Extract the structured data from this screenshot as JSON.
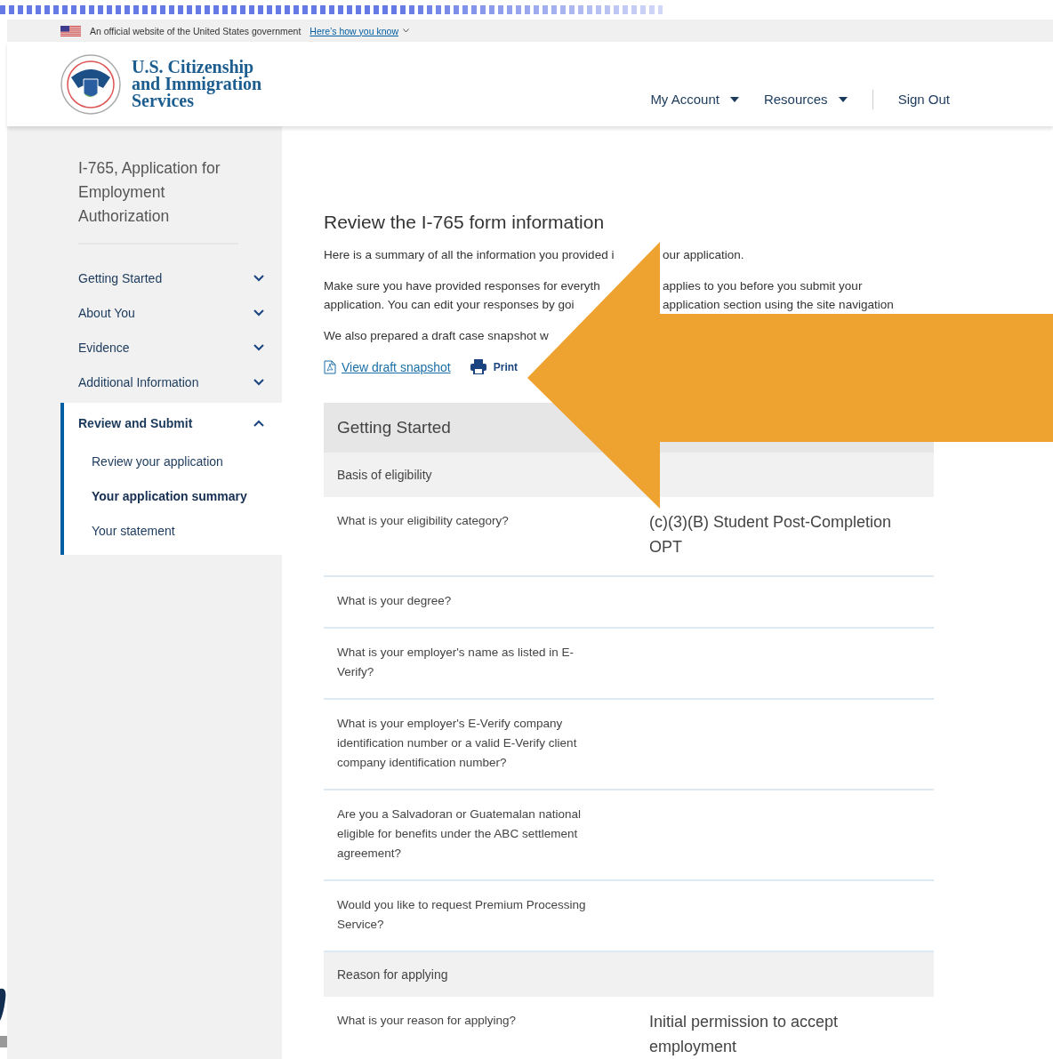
{
  "banner": {
    "text": "An official website of the United States government",
    "link": "Here’s how you know"
  },
  "header": {
    "agency_name": [
      "U.S. Citizenship",
      "and Immigration",
      "Services"
    ],
    "nav": [
      {
        "label": "My Account",
        "kind": "dropdown"
      },
      {
        "label": "Resources",
        "kind": "dropdown"
      },
      {
        "label": "Sign Out",
        "kind": "link"
      }
    ]
  },
  "sidebar": {
    "title": "I-765, Application for Employment Authorization",
    "sections": [
      {
        "label": "Getting Started",
        "expanded": false,
        "selected": false
      },
      {
        "label": "About You",
        "expanded": false,
        "selected": false
      },
      {
        "label": "Evidence",
        "expanded": false,
        "selected": false
      },
      {
        "label": "Additional Information",
        "expanded": false,
        "selected": false
      },
      {
        "label": "Review and Submit",
        "expanded": true,
        "selected": true,
        "children": [
          {
            "label": "Review your application",
            "selected": false
          },
          {
            "label": "Your application summary",
            "selected": true
          },
          {
            "label": "Your statement",
            "selected": false
          }
        ]
      }
    ]
  },
  "main": {
    "heading": "Review the I-765 form information",
    "paragraphs": [
      {
        "lines": [
          [
            "Here is a summary of all the information you provided i",
            "our application."
          ]
        ]
      },
      {
        "lines": [
          [
            "Make sure you have provided responses for everyth",
            "applies to you before you submit your"
          ],
          [
            "application. You can edit your responses by goi",
            "application section using the site navigation"
          ]
        ]
      },
      {
        "lines": [
          [
            "We also prepared a draft case snapshot w"
          ]
        ]
      }
    ],
    "links": [
      {
        "label": "View draft snapshot",
        "kind": "pdf"
      },
      {
        "label": "Print",
        "kind": "print"
      }
    ],
    "sections": [
      {
        "title": "Getting Started",
        "groups": [
          {
            "title": "Basis of eligibility",
            "rows": [
              {
                "question": "What is your eligibility category?",
                "answer": "(c)(3)(B) Student Post-Completion OPT"
              },
              {
                "question": "What is your degree?"
              },
              {
                "question": "What is your employer's name as listed in E-Verify?"
              },
              {
                "question": "What is your employer's E-Verify company identification number or a valid E-Verify client company identification number?"
              },
              {
                "question": "Are you a Salvadoran or Guatemalan national eligible for benefits under the ABC settlement agreement?"
              },
              {
                "question": "Would you like to request Premium Processing Service?"
              }
            ]
          },
          {
            "title": "Reason for applying",
            "rows": [
              {
                "question": "What is your reason for applying?",
                "answer": "Initial permission to accept employment"
              }
            ]
          }
        ]
      }
    ]
  }
}
